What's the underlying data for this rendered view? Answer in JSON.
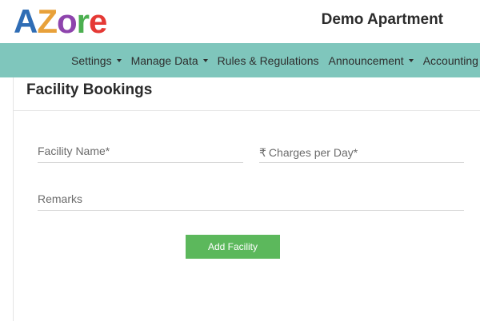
{
  "brand": {
    "letters": [
      {
        "char": "A",
        "color": "#2f6db5"
      },
      {
        "char": "Z",
        "color": "#e8a13a"
      },
      {
        "char": "o",
        "color": "#8e44ad"
      },
      {
        "char": "r",
        "color": "#4caf50"
      },
      {
        "char": "e",
        "color": "#e53935"
      }
    ]
  },
  "header": {
    "apartment_name": "Demo Apartment"
  },
  "nav": {
    "items": [
      {
        "label": "Settings",
        "dropdown": true
      },
      {
        "label": "Manage Data",
        "dropdown": true
      },
      {
        "label": "Rules & Regulations",
        "dropdown": false
      },
      {
        "label": "Announcement",
        "dropdown": true
      },
      {
        "label": "Accounting",
        "dropdown": true
      }
    ]
  },
  "page": {
    "title": "Facility Bookings"
  },
  "form": {
    "facility_name": {
      "placeholder": "Facility Name*",
      "value": ""
    },
    "charges": {
      "currency_symbol": "₹",
      "placeholder": "Charges per Day*",
      "value": ""
    },
    "remarks": {
      "placeholder": "Remarks",
      "value": ""
    },
    "submit_label": "Add Facility"
  },
  "colors": {
    "navbar": "#7fc6bc",
    "button": "#5cb85c"
  }
}
